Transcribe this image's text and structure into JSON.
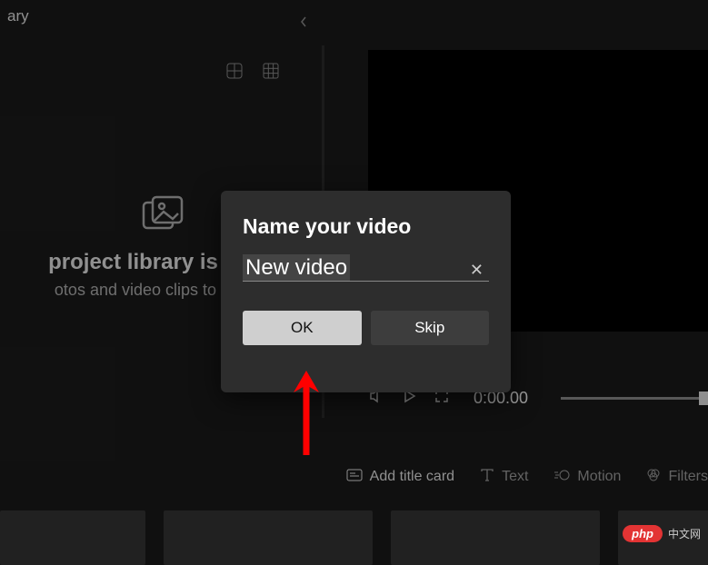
{
  "header": {
    "title_fragment": "ary"
  },
  "library": {
    "title": " project library is empt",
    "subtitle": "otos and video clips to get sta"
  },
  "playback": {
    "timecode": "0:00.00"
  },
  "storyboard": {
    "add_title_card": "Add title card",
    "text": "Text",
    "motion": "Motion",
    "filters": "Filters"
  },
  "modal": {
    "title": "Name your video",
    "input_value": "New video",
    "ok": "OK",
    "skip": "Skip"
  },
  "watermark": {
    "badge": "php",
    "text": "中文网"
  }
}
